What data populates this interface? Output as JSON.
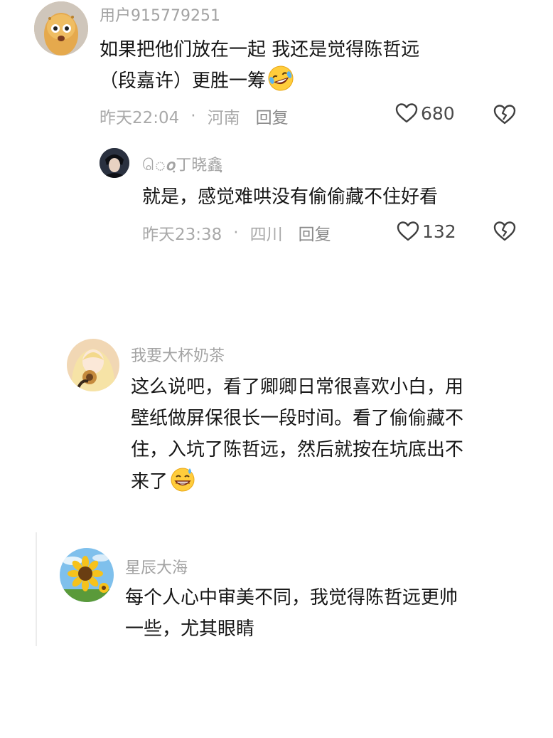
{
  "comments": [
    {
      "username": "用户915779251",
      "lines": [
        "如果把他们放在一起 我还是觉得陈哲远",
        "（段嘉许）更胜一筹"
      ],
      "emoji": "rofl-emoji",
      "time": "昨天22:04",
      "location": "河南",
      "reply": "回复",
      "likes": "680",
      "replies": [
        {
          "username": "ெ𝒐ฺ丁晓鑫ฺ",
          "lines": [
            "就是，感觉难哄没有偷偷藏不住好看"
          ],
          "time": "昨天23:38",
          "location": "四川",
          "reply": "回复",
          "likes": "132"
        }
      ]
    },
    {
      "username": "我要大杯奶茶",
      "lines": [
        "这么说吧，看了卿卿日常很喜欢小白，用",
        "壁纸做屏保很长一段时间。看了偷偷藏不",
        "住，入坑了陈哲远，然后就按在坑底出不",
        "来了"
      ],
      "emoji": "grin-sweat-emoji"
    },
    {
      "username": "星辰大海",
      "lines": [
        "每个人心中审美不同，我觉得陈哲远更帅",
        "一些，尤其眼睛"
      ]
    }
  ],
  "colors": {
    "username": "#a3a3a3",
    "meta": "#a9a9a9",
    "text": "#161616",
    "icon": "#3f3f3f"
  }
}
